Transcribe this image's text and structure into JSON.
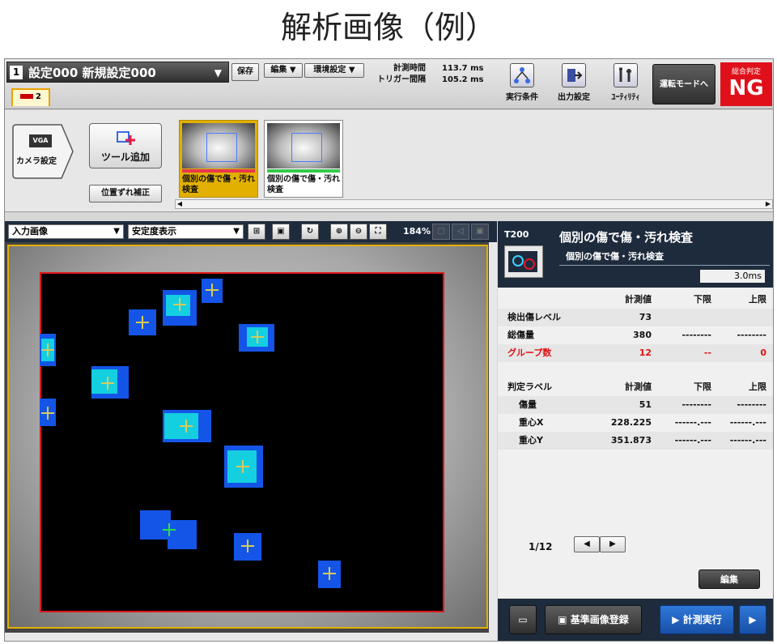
{
  "page_title": "解析画像（例）",
  "header": {
    "setting_number": "1",
    "setting_name": "設定000 新規設定000",
    "save_label": "保存",
    "edit_menu": "編集 ▼",
    "env_menu": "環境設定 ▼",
    "meas_time_label": "計測時間",
    "meas_time_value": "113.7 ms",
    "trigger_label": "トリガー間隔",
    "trigger_value": "105.2 ms",
    "tab_label": "2",
    "exec_cond": "実行条件",
    "output_setting": "出力設定",
    "utility": "ﾕｰﾃｨﾘﾃｨ",
    "run_mode": "運転モードへ",
    "overall_label": "総合判定",
    "overall_value": "NG",
    "ng_color": "#e0101a"
  },
  "toolbar": {
    "camera_badge": "VGA",
    "camera_label": "カメラ設定",
    "tool_add": "ツール追加",
    "position_fix": "位置ずれ補正",
    "thumbs": [
      {
        "label": "個別の傷で傷・汚れ検査",
        "selected": true,
        "bar_color": "#e8384f"
      },
      {
        "label": "個別の傷で傷・汚れ検査",
        "selected": false,
        "bar_color": "#34c94a"
      }
    ]
  },
  "view": {
    "image_select": "入力画像",
    "display_select": "安定度表示",
    "zoom": "184%"
  },
  "panel": {
    "tool_id": "T200",
    "title": "個別の傷で傷・汚れ検査",
    "subtitle": "個別の傷で傷・汚れ検査",
    "time": "3.0ms",
    "table1_header": [
      "",
      "計測値",
      "下限",
      "上限"
    ],
    "table1": [
      [
        "検出傷レベル",
        "73",
        "",
        ""
      ],
      [
        "総傷量",
        "380",
        "--------",
        "--------"
      ],
      [
        "グループ数",
        "12",
        "--",
        "0"
      ]
    ],
    "table2_header": [
      "判定ラベル",
      "計測値",
      "下限",
      "上限"
    ],
    "table2": [
      [
        "傷量",
        "51",
        "--------",
        "--------"
      ],
      [
        "重心X",
        "228.225",
        "------.---",
        "------.---"
      ],
      [
        "重心Y",
        "351.873",
        "------.---",
        "------.---"
      ]
    ],
    "page": "1/12",
    "prev": "◀",
    "next": "▶",
    "edit": "編集",
    "ref_register": "基準画像登録",
    "run_measure": "計測実行"
  }
}
